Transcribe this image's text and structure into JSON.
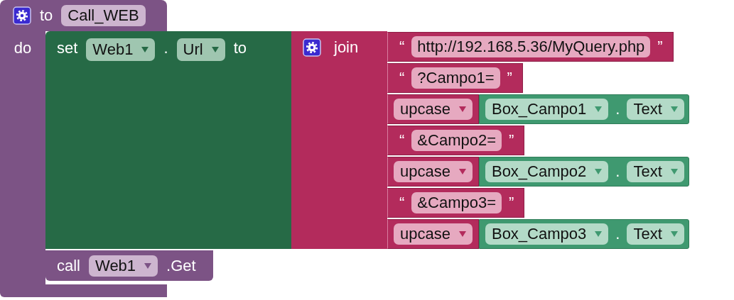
{
  "procedure": {
    "keyword": "to",
    "name": "Call_WEB",
    "do_label": "do",
    "body": [
      {
        "kind": "set",
        "keyword": "set",
        "component": "Web1",
        "dot": ".",
        "property": "Url",
        "to_label": "to",
        "value": {
          "kind": "join",
          "label": "join",
          "items": [
            {
              "kind": "text",
              "open_quote": "“",
              "value": "http://192.168.5.36/MyQuery.php",
              "close_quote": "”"
            },
            {
              "kind": "text",
              "open_quote": "“",
              "value": "?Campo1=",
              "close_quote": "”"
            },
            {
              "kind": "upcase",
              "op": "upcase",
              "arg": {
                "component": "Box_Campo1",
                "dot": ".",
                "property": "Text"
              }
            },
            {
              "kind": "text",
              "open_quote": "“",
              "value": "&Campo2=",
              "close_quote": "”"
            },
            {
              "kind": "upcase",
              "op": "upcase",
              "arg": {
                "component": "Box_Campo2",
                "dot": ".",
                "property": "Text"
              }
            },
            {
              "kind": "text",
              "open_quote": "“",
              "value": "&Campo3=",
              "close_quote": "”"
            },
            {
              "kind": "upcase",
              "op": "upcase",
              "arg": {
                "component": "Box_Campo3",
                "dot": ".",
                "property": "Text"
              }
            }
          ]
        }
      },
      {
        "kind": "call",
        "keyword": "call",
        "component": "Web1",
        "method": ".Get"
      }
    ]
  }
}
